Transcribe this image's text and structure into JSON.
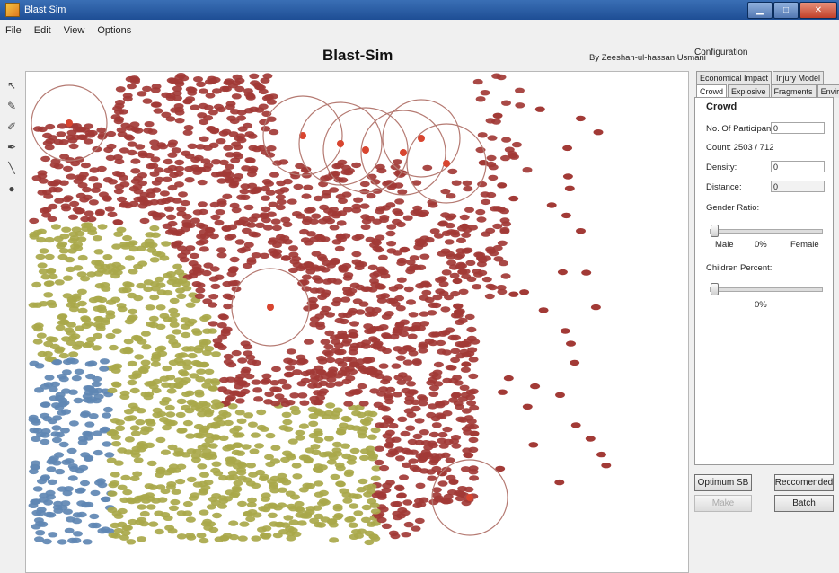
{
  "window": {
    "title": "Blast Sim"
  },
  "menu": [
    "File",
    "Edit",
    "View",
    "Options"
  ],
  "tools": [
    "pointer-icon",
    "pencil-icon",
    "brush-icon",
    "pen-icon",
    "line-icon",
    "eraser-icon"
  ],
  "header": {
    "title": "Blast-Sim",
    "byline": "By Zeeshan-ul-hassan Usmani"
  },
  "config": {
    "label": "Configuration",
    "tabs_top": [
      "Economical Impact",
      "Injury Model"
    ],
    "tabs_bottom": [
      "Crowd",
      "Explosive",
      "Fragments",
      "Environment"
    ],
    "active_tab": "Crowd",
    "crowd": {
      "title": "Crowd",
      "participants_label": "No. Of Participants",
      "participants_value": "0",
      "count_text": "Count: 2503 / 712",
      "density_label": "Density:",
      "density_value": "0",
      "distance_label": "Distance:",
      "distance_value": "0",
      "gender_label": "Gender Ratio:",
      "male_label": "Male",
      "gender_value": "0%",
      "female_label": "Female",
      "gender_ratio": 0,
      "children_label": "Children Percent:",
      "children_value": "0%",
      "children_percent": 0
    },
    "buttons": {
      "optimum": "Optimum SB",
      "recommended": "Reccomended",
      "make": "Make",
      "batch": "Batch"
    }
  },
  "colors": {
    "red": "#a23a36",
    "yellow": "#a9a84a",
    "blue": "#5f87b3",
    "blast_ring": "#b57a72",
    "bomb": "#d8452f"
  }
}
